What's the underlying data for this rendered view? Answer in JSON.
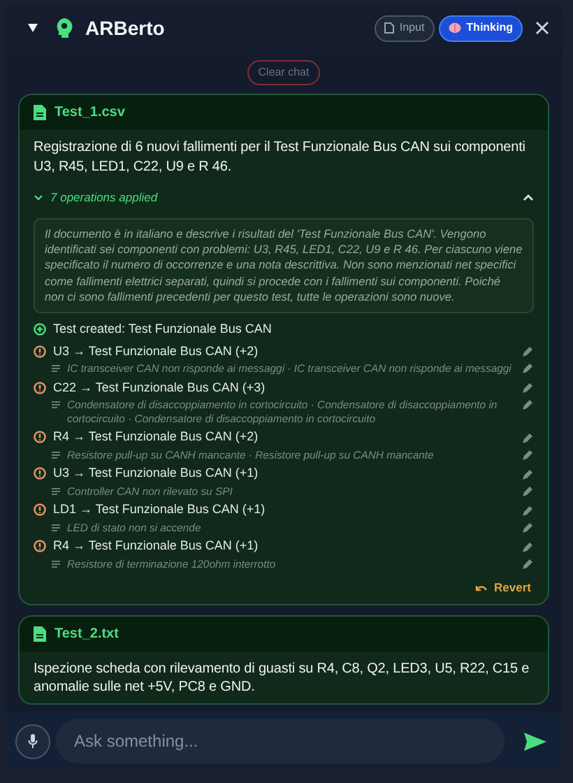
{
  "header": {
    "title": "ARBerto",
    "modes": [
      {
        "label": "Input",
        "selected": false,
        "kind": "file"
      },
      {
        "label": "Thinking",
        "selected": true,
        "kind": "brain"
      }
    ]
  },
  "clear_button": "Clear chat",
  "messages": [
    {
      "file": "Test_1.csv",
      "summary": "Registrazione di 6 nuovi fallimenti per il Test Funzionale Bus CAN sui componenti U3, R45, LED1, C22, U9 e R 46.",
      "operations_label": "7 operations applied",
      "expanded": true,
      "reasoning": "Il documento è in italiano e descrive i risultati del 'Test Funzionale Bus CAN'. Vengono identificati sei componenti con problemi: U3, R45, LED1, C22, U9 e R 46. Per ciascuno viene specificato il numero di occorrenze e una nota descrittiva. Non sono menzionati net specifici come fallimenti elettrici separati, quindi si procede con i fallimenti sui componenti. Poiché non ci sono fallimenti precedenti per questo test, tutte le operazioni sono nuove.",
      "operations": [
        {
          "kind": "created",
          "text": "Test created: Test Funzionale Bus CAN"
        },
        {
          "kind": "failure",
          "text": "U3 → Test Funzionale Bus CAN (+2)",
          "note": "IC transceiver CAN non risponde ai messaggi · IC transceiver CAN non risponde ai messaggi"
        },
        {
          "kind": "failure",
          "text": "C22 → Test Funzionale Bus CAN (+3)",
          "note": "Condensatore di disaccoppiamento in cortocircuito · Condensatore di disaccoppiamento in cortocircuito · Condensatore di disaccoppiamento in cortocircuito"
        },
        {
          "kind": "failure",
          "text": "R4 → Test Funzionale Bus CAN (+2)",
          "note": "Resistore pull-up su CANH mancante · Resistore pull-up su CANH mancante"
        },
        {
          "kind": "failure",
          "text": "U3 → Test Funzionale Bus CAN (+1)",
          "note": "Controller CAN non rilevato su SPI"
        },
        {
          "kind": "failure",
          "text": "LD1 → Test Funzionale Bus CAN (+1)",
          "note": "LED di stato non si accende"
        },
        {
          "kind": "failure",
          "text": "R4 → Test Funzionale Bus CAN (+1)",
          "note": "Resistore di terminazione 120ohm interrotto"
        }
      ],
      "revert": "Revert"
    },
    {
      "file": "Test_2.txt",
      "summary": "Ispezione scheda con rilevamento di guasti su R4, C8, Q2, LED3, U5, R22, C15 e anomalie sulle net +5V, PC8 e GND.",
      "expanded": false
    }
  ],
  "composer": {
    "placeholder": "Ask something..."
  }
}
